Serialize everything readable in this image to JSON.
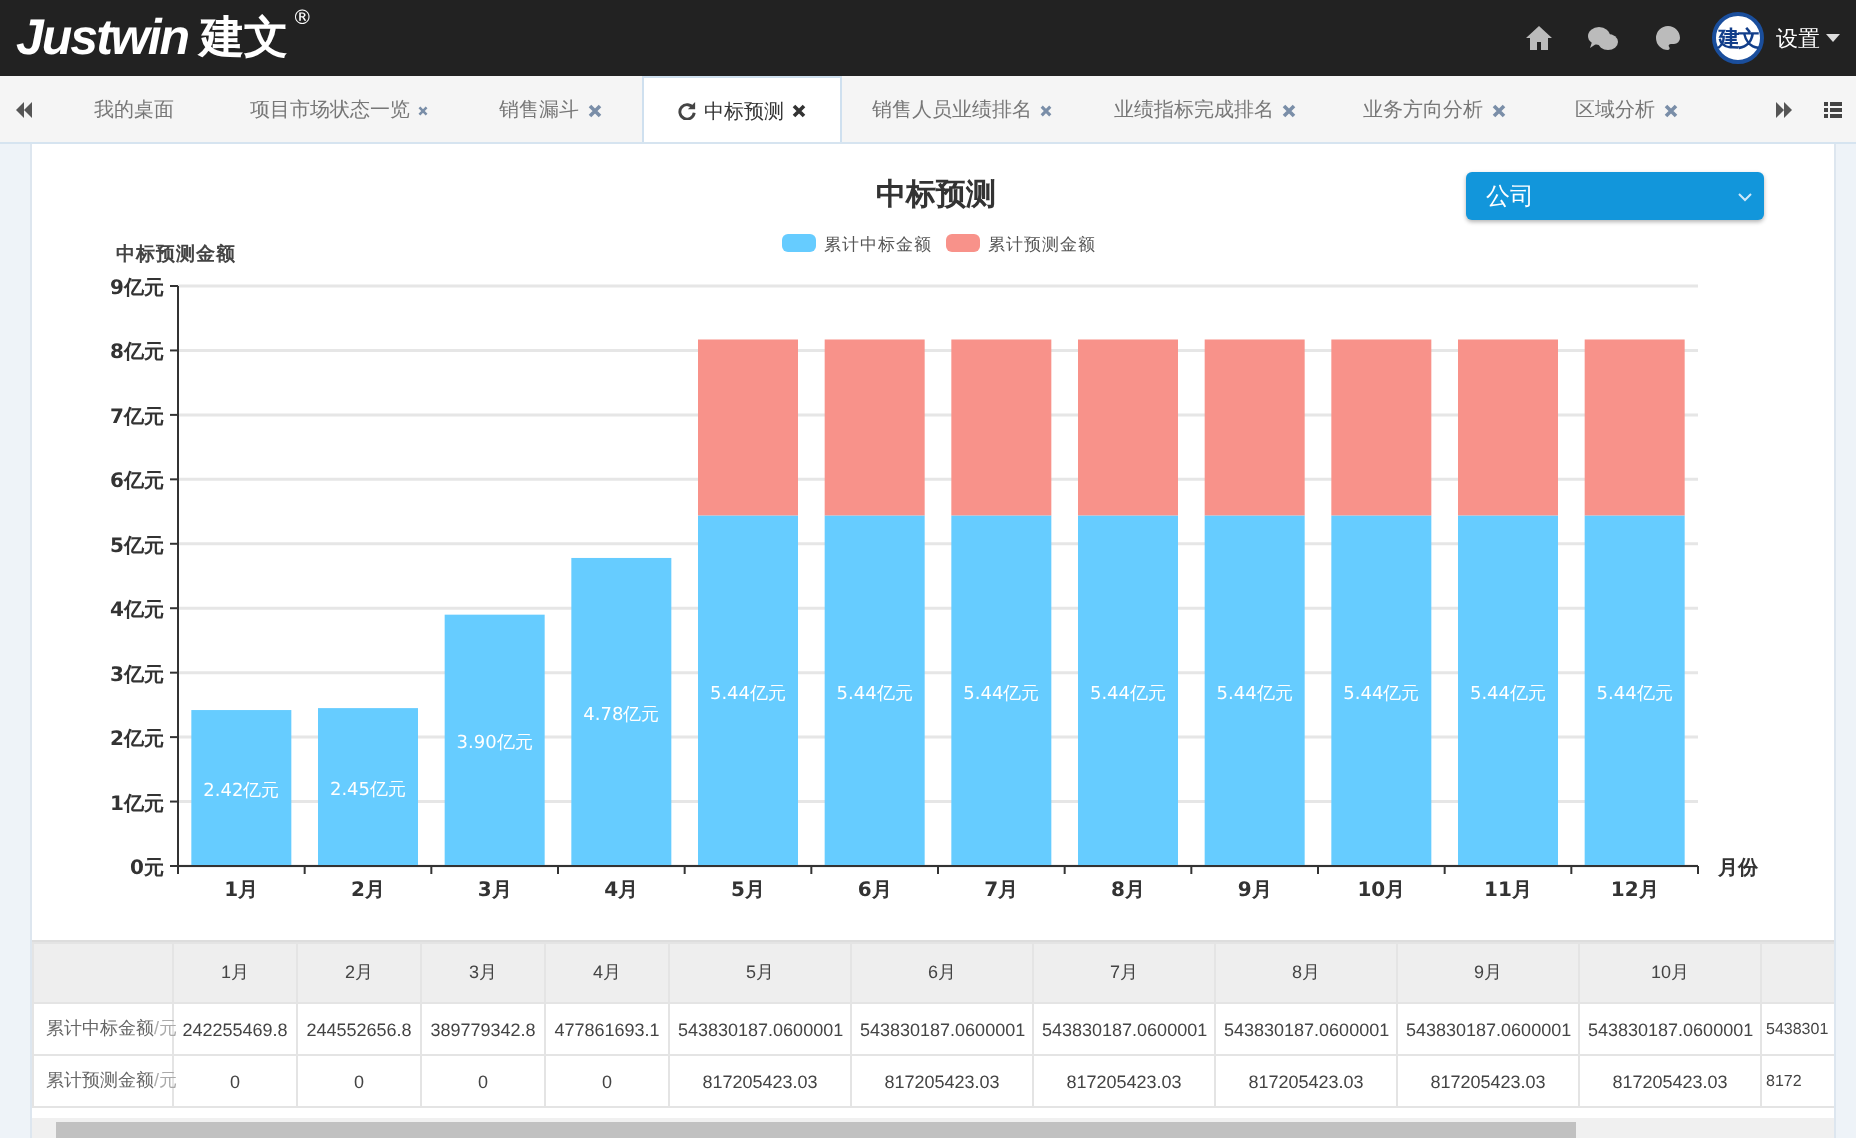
{
  "header": {
    "logo": "Justwin",
    "logo_cn": "建文",
    "registered": "®",
    "avatar_text": "建文",
    "settings": "设置"
  },
  "tabs": [
    {
      "label": "我的桌面",
      "selected": false,
      "closable": false,
      "refresh": false
    },
    {
      "label": "项目市场状态一览",
      "selected": false,
      "closable": true,
      "refresh": false
    },
    {
      "label": "销售漏斗",
      "selected": false,
      "closable": true,
      "refresh": false
    },
    {
      "label": "中标预测",
      "selected": true,
      "closable": true,
      "refresh": true
    },
    {
      "label": "销售人员业绩排名",
      "selected": false,
      "closable": true,
      "refresh": false
    },
    {
      "label": "业绩指标完成排名",
      "selected": false,
      "closable": true,
      "refresh": false
    },
    {
      "label": "业务方向分析",
      "selected": false,
      "closable": true,
      "refresh": false
    },
    {
      "label": "区域分析",
      "selected": false,
      "closable": true,
      "refresh": false
    }
  ],
  "chart": {
    "dropdown": {
      "value": "公司"
    },
    "chart_data": {
      "type": "bar",
      "title": "中标预测",
      "xlabel": "月份",
      "ylabel": "中标预测金额",
      "stacked": true,
      "orientation": "vertical",
      "grid": true,
      "legend": true,
      "categories": [
        "1月",
        "2月",
        "3月",
        "4月",
        "5月",
        "6月",
        "7月",
        "8月",
        "9月",
        "10月",
        "11月",
        "12月"
      ],
      "series": [
        {
          "name": "累计中标金额",
          "color": "#66ccff",
          "values": [
            2.42,
            2.45,
            3.9,
            4.78,
            5.44,
            5.44,
            5.44,
            5.44,
            5.44,
            5.44,
            5.44,
            5.44
          ]
        },
        {
          "name": "累计预测金额",
          "color": "#f8928a",
          "values": [
            0,
            0,
            0,
            0,
            2.73,
            2.73,
            2.73,
            2.73,
            2.73,
            2.73,
            2.73,
            2.73
          ]
        }
      ],
      "ylim": [
        0,
        9
      ],
      "yticks": [
        {
          "value": 0,
          "label": "0元"
        },
        {
          "value": 1,
          "label": "1亿元"
        },
        {
          "value": 2,
          "label": "2亿元"
        },
        {
          "value": 3,
          "label": "3亿元"
        },
        {
          "value": 4,
          "label": "4亿元"
        },
        {
          "value": 5,
          "label": "5亿元"
        },
        {
          "value": 6,
          "label": "6亿元"
        },
        {
          "value": 7,
          "label": "7亿元"
        },
        {
          "value": 8,
          "label": "8亿元"
        },
        {
          "value": 9,
          "label": "9亿元"
        }
      ],
      "value_labels": [
        "2.42亿元",
        "2.45亿元",
        "3.90亿元",
        "4.78亿元",
        "5.44亿元",
        "5.44亿元",
        "5.44亿元",
        "5.44亿元",
        "5.44亿元",
        "5.44亿元",
        "5.44亿元",
        "5.44亿元"
      ]
    }
  },
  "table": {
    "columns": [
      "1月",
      "2月",
      "3月",
      "4月",
      "5月",
      "6月",
      "7月",
      "8月",
      "9月",
      "10月"
    ],
    "rows": [
      {
        "label": "累计中标金额",
        "unit": "/元",
        "cells": [
          "242255469.8",
          "244552656.8",
          "389779342.8",
          "477861693.1",
          "543830187.0600001",
          "543830187.0600001",
          "543830187.0600001",
          "543830187.0600001",
          "543830187.0600001",
          "543830187.0600001",
          "5438301"
        ]
      },
      {
        "label": "累计预测金额",
        "unit": "/元",
        "cells": [
          "0",
          "0",
          "0",
          "0",
          "817205423.03",
          "817205423.03",
          "817205423.03",
          "817205423.03",
          "817205423.03",
          "817205423.03",
          "8172"
        ]
      }
    ]
  }
}
